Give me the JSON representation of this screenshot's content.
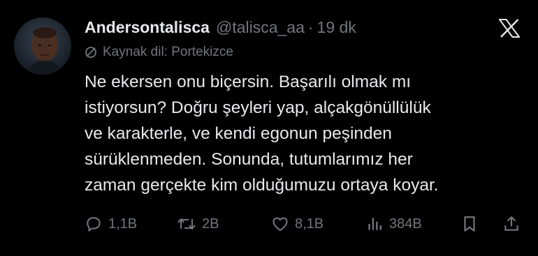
{
  "tweet": {
    "display_name": "Andersontalisca",
    "handle": "@talisca_aa",
    "separator": "·",
    "time": "19 dk",
    "source_label": "Kaynak dil: Portekizce",
    "body_lines": [
      "Ne ekersen onu biçersin. Başarılı olmak mı",
      "istiyorsun? Doğru şeyleri yap, alçakgönüllülük",
      "ve karakterle, ve kendi egonun peşinden",
      "sürüklenmeden. Sonunda, tutumlarımız her",
      "zaman gerçekte kim olduğumuzu ortaya koyar."
    ]
  },
  "actions": {
    "replies": "1,1B",
    "reposts": "2B",
    "likes": "8,1B",
    "views": "384B"
  },
  "icons": {
    "logo": "x-logo-icon",
    "translate": "translate-icon",
    "reply": "reply-icon",
    "repost": "repost-icon",
    "like": "heart-icon",
    "views": "views-icon",
    "bookmark": "bookmark-icon",
    "share": "share-icon"
  },
  "colors": {
    "background": "#000000",
    "primary_text": "#e7e9ea",
    "secondary_text": "#71767b"
  }
}
